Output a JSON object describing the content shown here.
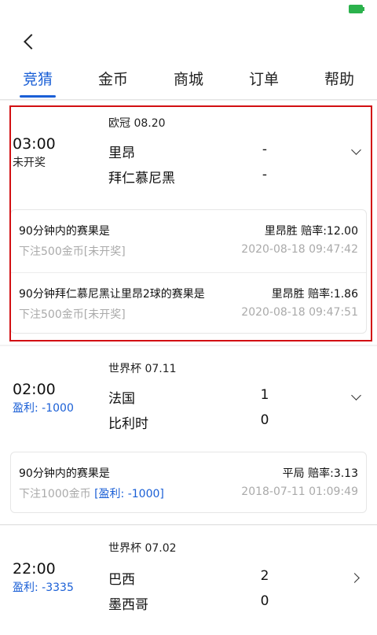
{
  "tabs": [
    "竞猜",
    "金币",
    "商城",
    "订单",
    "帮助"
  ],
  "matches": [
    {
      "league": "欧冠 08.20",
      "time": "03:00",
      "status": "未开奖",
      "team1": "里昂",
      "score1": "-",
      "team2": "拜仁慕尼黑",
      "score2": "-",
      "bets": [
        {
          "question": "90分钟内的赛果是",
          "answer": "里昂胜 赔率:12.00",
          "stake": "下注500金币",
          "result": "[未开奖]",
          "time": "2020-08-18 09:47:42"
        },
        {
          "question": "90分钟拜仁慕尼黑让里昂2球的赛果是",
          "answer": "里昂胜 赔率:1.86",
          "stake": "下注500金币",
          "result": "[未开奖]",
          "time": "2020-08-18 09:47:51"
        }
      ]
    },
    {
      "league": "世界杯 07.11",
      "time": "02:00",
      "status": "盈利: -1000",
      "team1": "法国",
      "score1": "1",
      "team2": "比利时",
      "score2": "0",
      "bets": [
        {
          "question": "90分钟内的赛果是",
          "answer": "平局 赔率:3.13",
          "stake": "下注1000金币",
          "result": "[盈利: -1000]",
          "time": "2018-07-11 01:09:49"
        }
      ]
    },
    {
      "league": "世界杯 07.02",
      "time": "22:00",
      "status": "盈利: -3335",
      "team1": "巴西",
      "score1": "2",
      "team2": "墨西哥",
      "score2": "0"
    }
  ],
  "colors": {
    "accent": "#1a5fd6",
    "highlight": "#d20f12",
    "muted": "#aaaaaa"
  }
}
